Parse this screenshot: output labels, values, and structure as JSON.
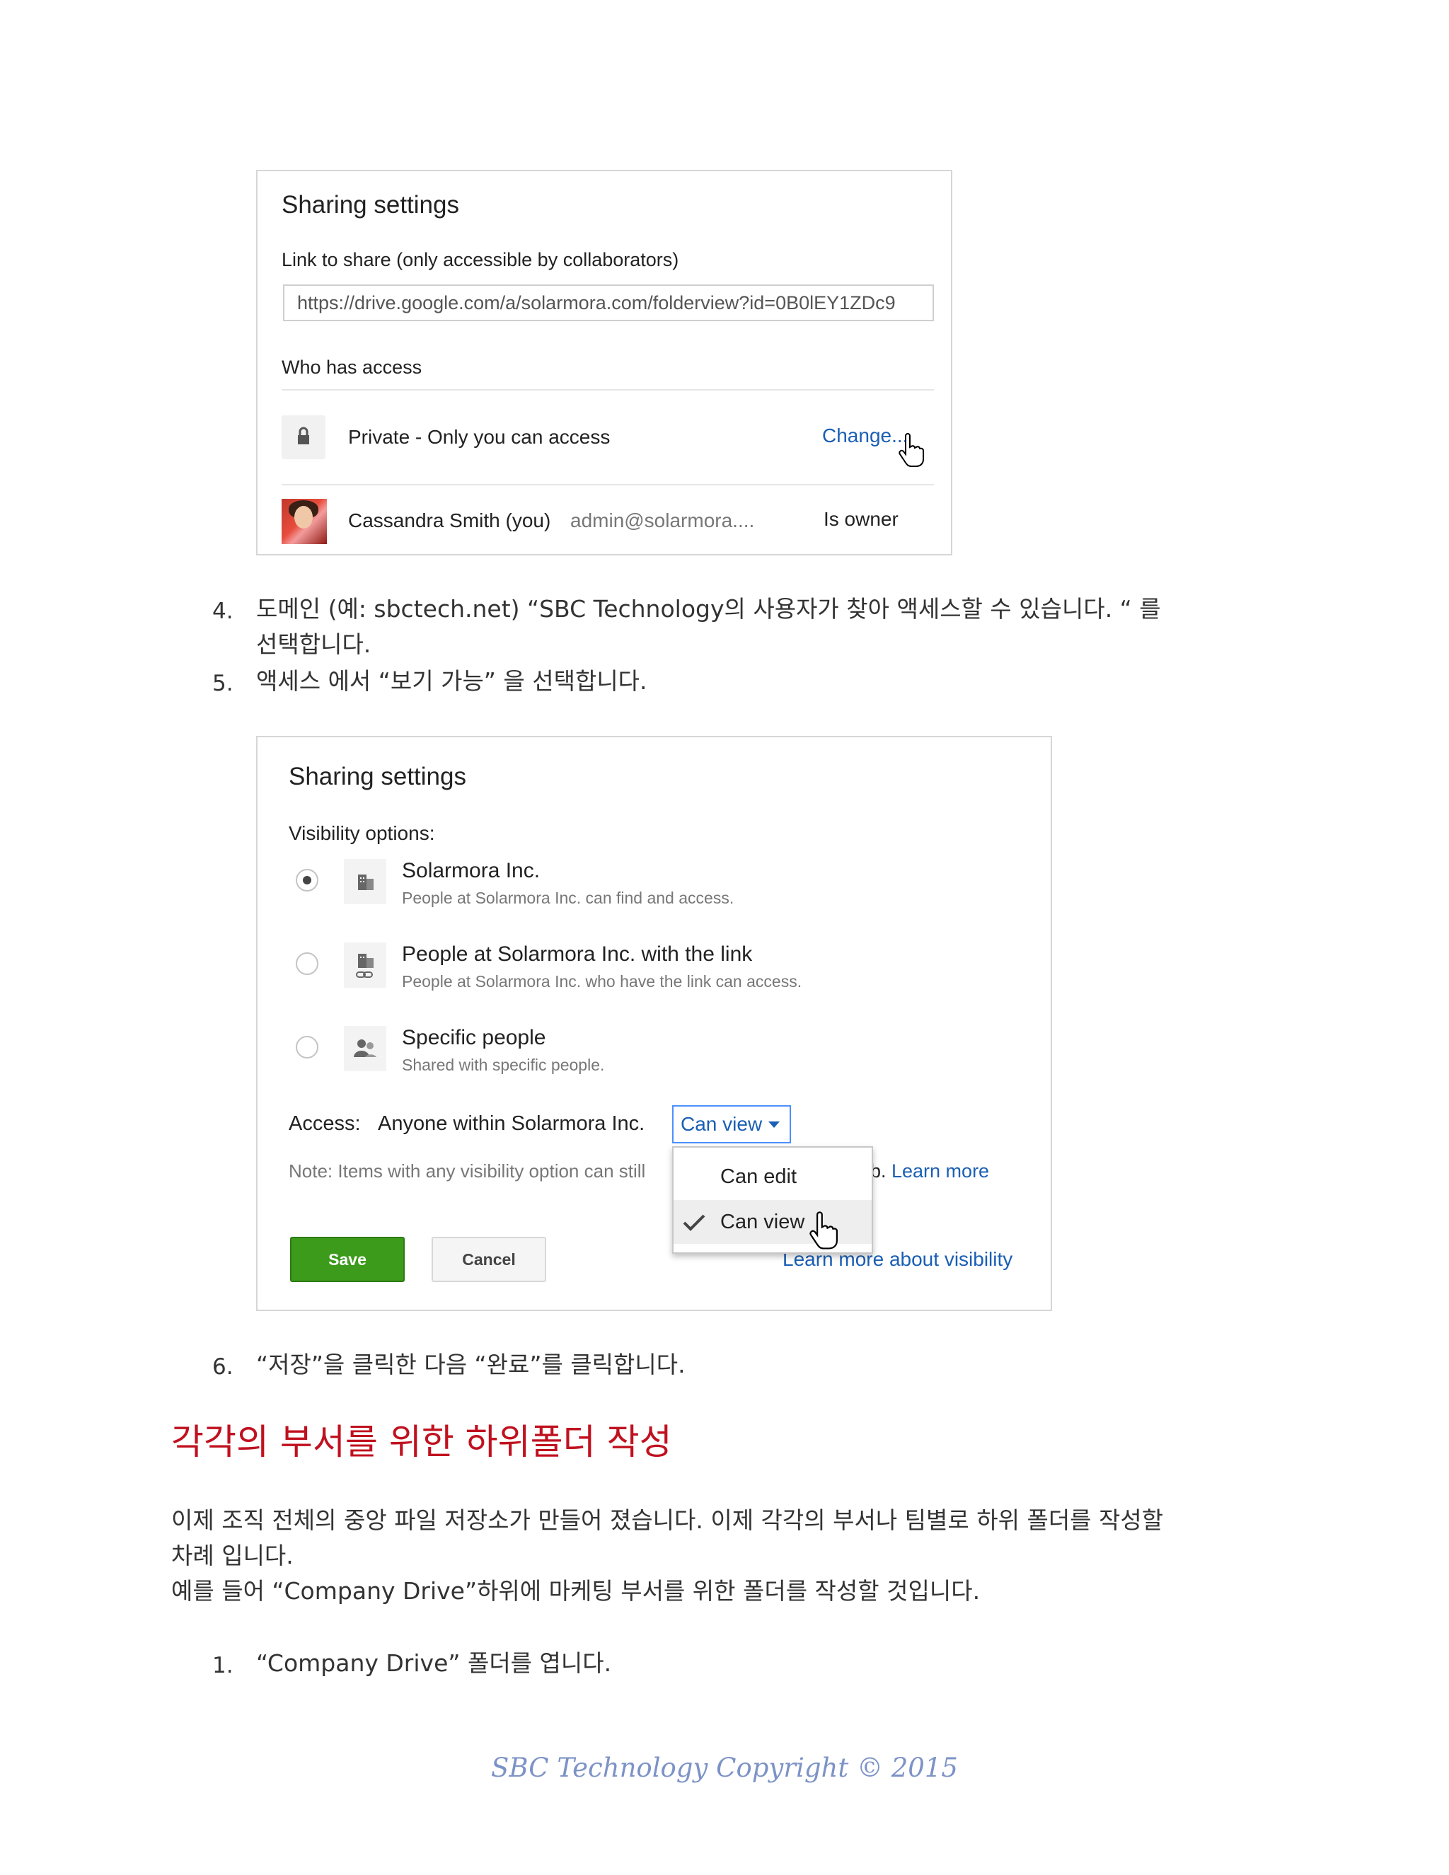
{
  "panel1": {
    "title": "Sharing settings",
    "link_label": "Link to share (only accessible by collaborators)",
    "link_url": "https://drive.google.com/a/solarmora.com/folderview?id=0B0lEY1ZDc9",
    "who_has_access": "Who has access",
    "private_row": {
      "icon": "lock-icon",
      "text": "Private - Only you can access",
      "action": "Change..."
    },
    "owner_row": {
      "name": "Cassandra Smith (you)",
      "email": "admin@solarmora....",
      "role": "Is owner"
    }
  },
  "steps_a": [
    {
      "num": "4.",
      "lines": [
        "도메인 (예: sbctech.net) “SBC Technology의  사용자가 찾아 액세스할 수 있습니다. “ 를",
        "선택합니다."
      ]
    },
    {
      "num": "5.",
      "lines": [
        "액세스 에서 “보기 가능” 을 선택합니다."
      ]
    }
  ],
  "panel2": {
    "title": "Sharing settings",
    "visibility_label": "Visibility options:",
    "options": [
      {
        "title": "Solarmora Inc.",
        "desc": "People at Solarmora Inc. can find and access.",
        "selected": true,
        "icon": "building-icon"
      },
      {
        "title": "People at Solarmora Inc. with the link",
        "desc": "People at Solarmora Inc. who have the link can access.",
        "selected": false,
        "icon": "building-link-icon"
      },
      {
        "title": "Specific people",
        "desc": "Shared with specific people.",
        "selected": false,
        "icon": "people-icon"
      }
    ],
    "access_label": "Access:",
    "access_scope": "Anyone within Solarmora Inc.",
    "access_value": "Can view",
    "note_text": "Note: Items with any visibility option can still",
    "note_tail": "b.",
    "learn_more": "Learn more",
    "dropdown_items": [
      "Can edit",
      "Can view"
    ],
    "learn_more_visibility": "Learn more about visibility",
    "save_label": "Save",
    "cancel_label": "Cancel"
  },
  "step6": {
    "num": "6.",
    "text": "“저장”을 클릭한 다음 “완료”를 클릭합니다."
  },
  "heading": "각각의 부서를 위한 하위폴더 작성",
  "paragraph": [
    "이제 조직 전체의 중앙 파일 저장소가 만들어 졌습니다. 이제 각각의 부서나 팀별로 하위 폴더를 작성할",
    "차례 입니다.",
    "예를 들어 “Company Drive”하위에  마케팅 부서를 위한 폴더를 작성할 것입니다."
  ],
  "step1": {
    "num": "1.",
    "text": "“Company  Drive”  폴더를 엽니다."
  },
  "footer": "SBC Technology Copyright © 2015"
}
